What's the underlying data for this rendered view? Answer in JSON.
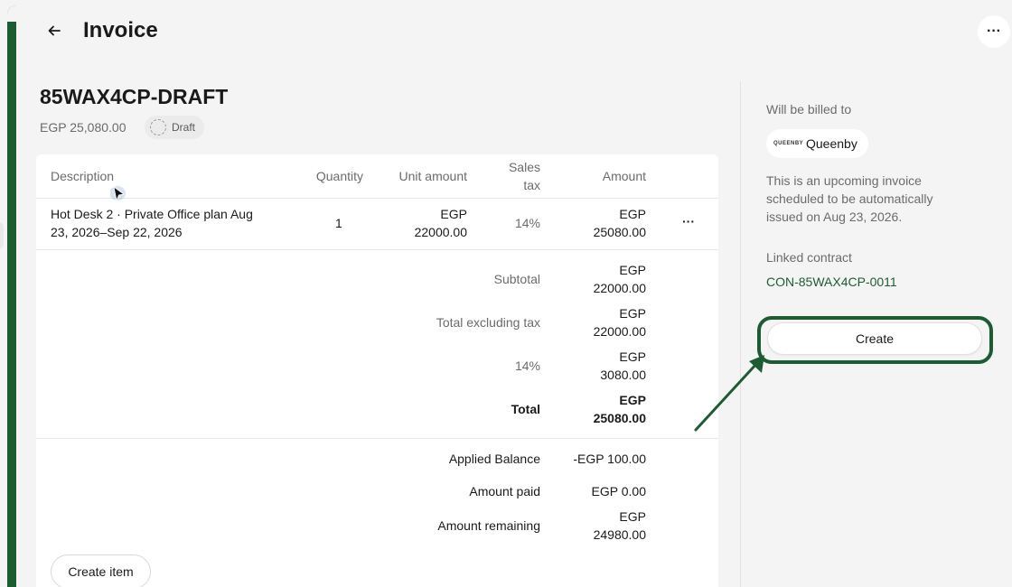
{
  "header": {
    "title": "Invoice",
    "more_glyph": "···"
  },
  "invoice": {
    "number": "85WAX4CP-DRAFT",
    "total_display": "EGP 25,080.00",
    "status": "Draft"
  },
  "table": {
    "headers": {
      "description": "Description",
      "quantity": "Quantity",
      "unit_amount": "Unit amount",
      "sales_tax_1": "Sales",
      "sales_tax_2": "tax",
      "amount": "Amount"
    },
    "item": {
      "description_1": "Hot Desk 2 · Private Office plan Aug",
      "description_2": "23, 2026–Sep 22, 2026",
      "quantity": "1",
      "unit_currency": "EGP",
      "unit_value": "22000.00",
      "tax": "14%",
      "amount_currency": "EGP",
      "amount_value": "25080.00"
    }
  },
  "totals": {
    "subtotal_label": "Subtotal",
    "subtotal_currency": "EGP",
    "subtotal_value": "22000.00",
    "excl_label": "Total excluding tax",
    "excl_currency": "EGP",
    "excl_value": "22000.00",
    "tax_label": "14%",
    "tax_currency": "EGP",
    "tax_value": "3080.00",
    "total_label": "Total",
    "total_currency": "EGP",
    "total_value": "25080.00"
  },
  "balance": {
    "applied_label": "Applied Balance",
    "applied_value": "-EGP 100.00",
    "paid_label": "Amount paid",
    "paid_value": "EGP 0.00",
    "remaining_label": "Amount remaining",
    "remaining_currency": "EGP",
    "remaining_value": "24980.00"
  },
  "actions": {
    "create_item": "Create item",
    "create": "Create"
  },
  "sidebar": {
    "billed_label": "Will be billed to",
    "customer_name": "Queenby",
    "customer_logo_text": "QUEENBY",
    "upcoming_text": "This is an upcoming invoice scheduled to be automatically issued on Aug 23, 2026.",
    "linked_contract_label": "Linked contract",
    "linked_contract_value": "CON-85WAX4CP-0011"
  },
  "colors": {
    "accent": "#1d5c32",
    "background": "#f4f4f4"
  },
  "icons": [
    "back-arrow-icon",
    "more-horizontal-icon",
    "draft-status-icon",
    "pointer-cursor-icon",
    "annotation-arrow-icon"
  ]
}
